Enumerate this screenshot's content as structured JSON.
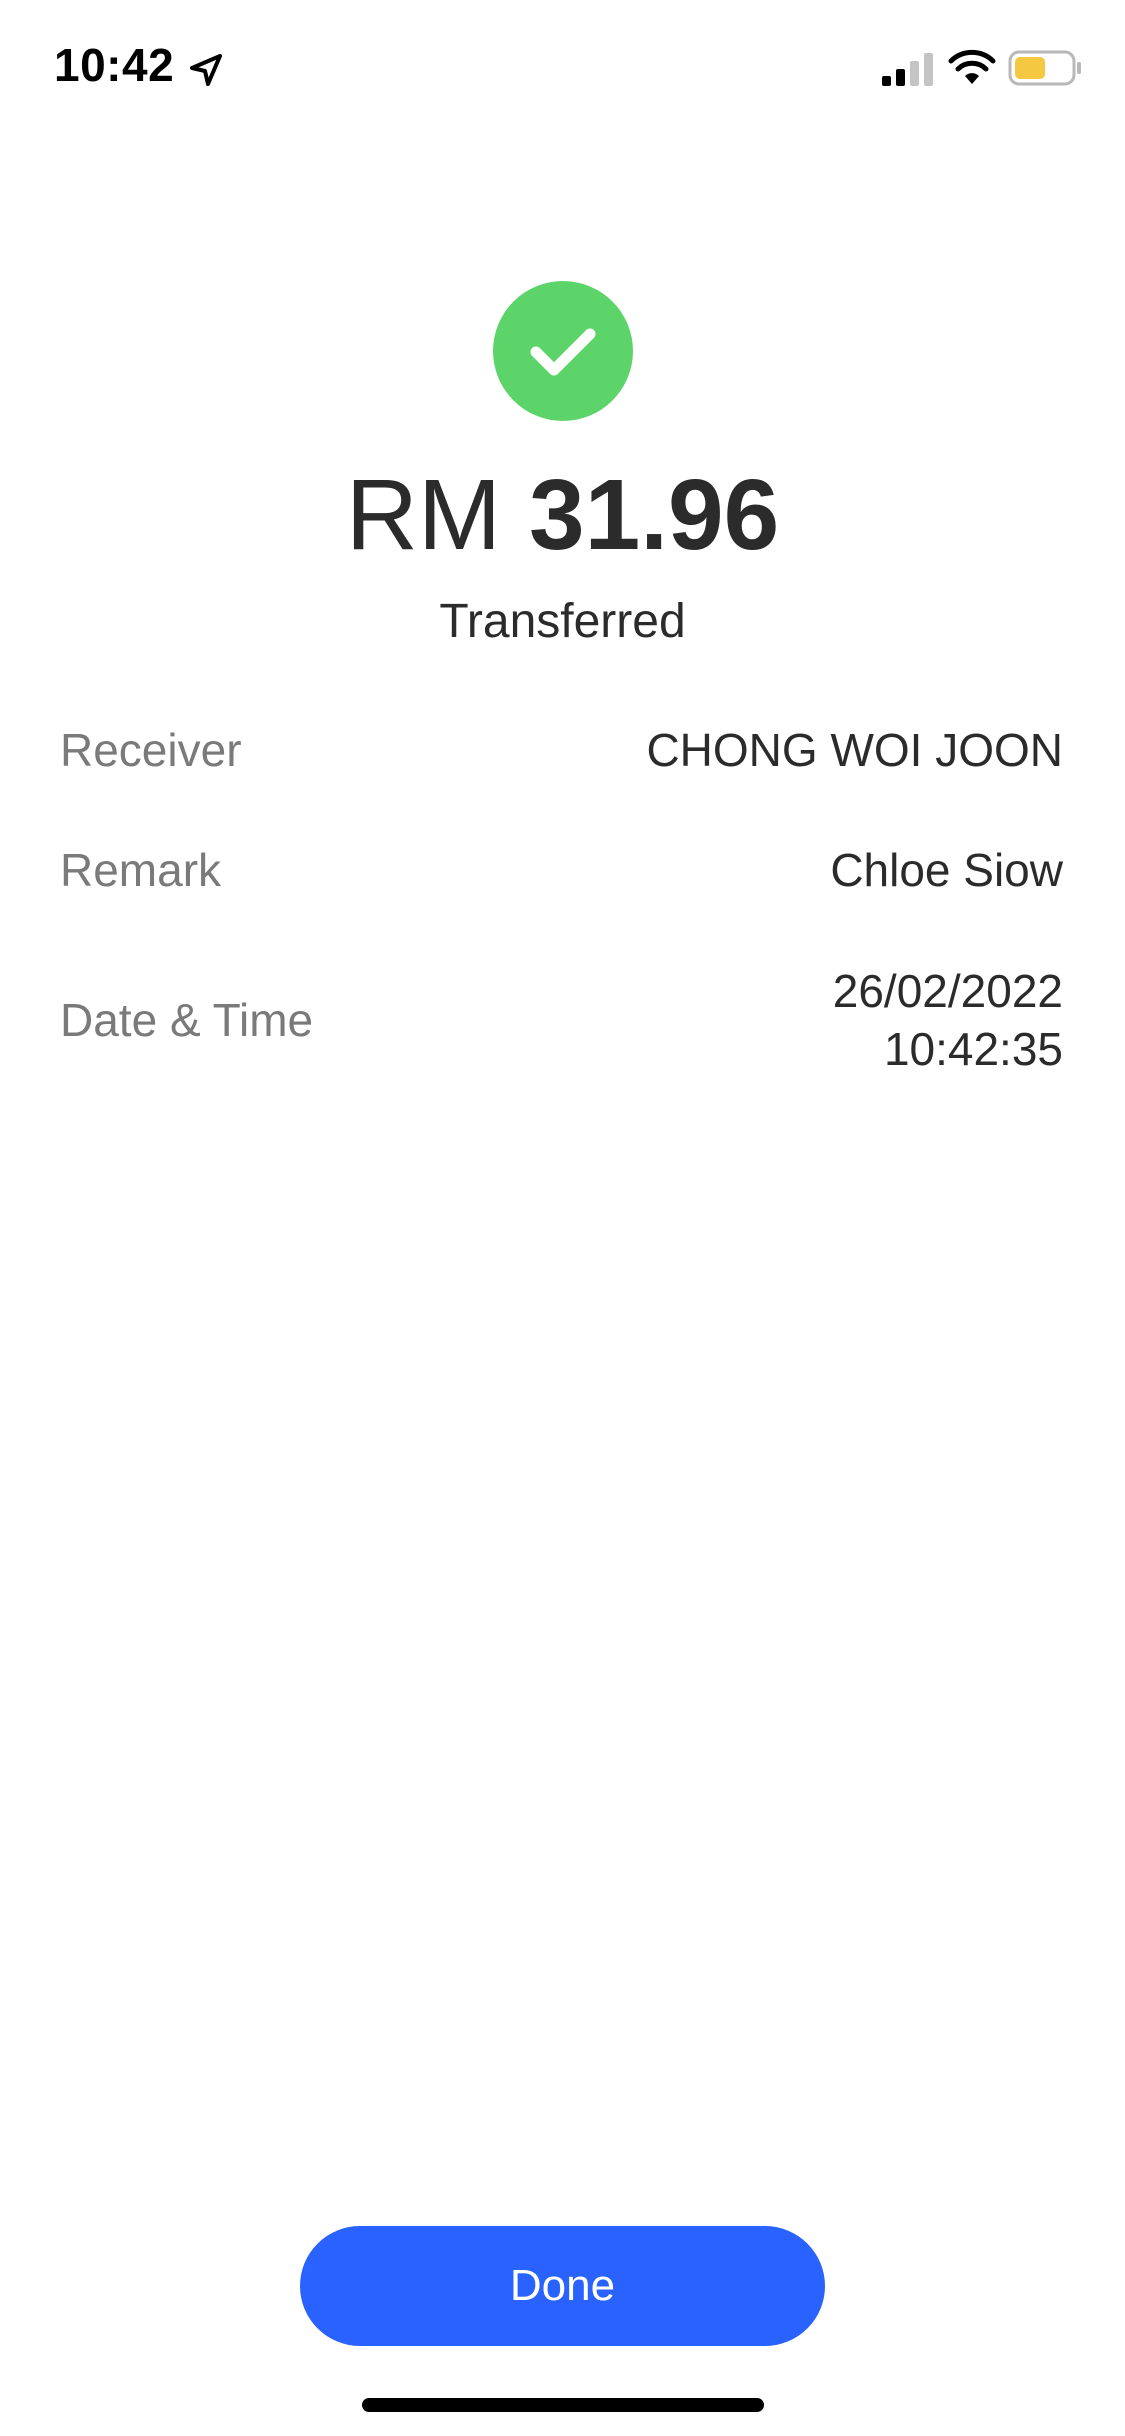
{
  "status_bar": {
    "time": "10:42",
    "icons": [
      "location-arrow-icon",
      "cellular-signal-icon",
      "wifi-icon",
      "battery-icon"
    ],
    "battery_color": "#f5c842"
  },
  "result": {
    "icon": "checkmark-circle-icon",
    "icon_color": "#5cd46a",
    "currency": "RM",
    "amount": "31.96",
    "status": "Transferred"
  },
  "details": [
    {
      "label": "Receiver",
      "value": [
        "CHONG WOI JOON"
      ]
    },
    {
      "label": "Remark",
      "value": [
        "Chloe Siow"
      ]
    },
    {
      "label": "Date & Time",
      "value": [
        "26/02/2022",
        "10:42:35"
      ]
    }
  ],
  "actions": {
    "done_label": "Done",
    "done_color": "#2962ff"
  }
}
